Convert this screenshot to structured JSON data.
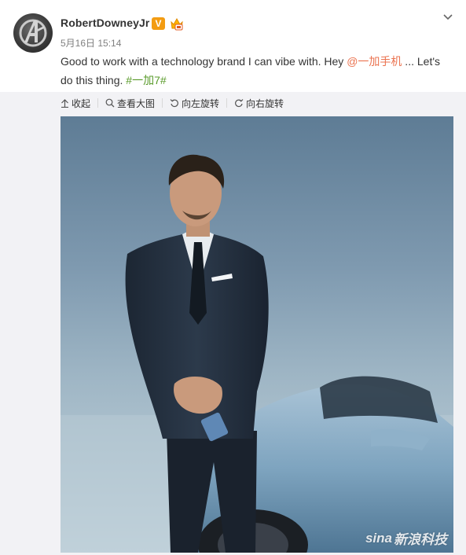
{
  "post": {
    "username": "RobertDowneyJr",
    "verified_badge": "V",
    "timestamp": "5月16日 15:14",
    "text_part1": "Good to work with a technology brand I can vibe with. Hey ",
    "mention": "@一加手机",
    "text_part2": " ... Let's do this thing. ",
    "hashtag": "#一加7#"
  },
  "toolbar": {
    "collapse": "收起",
    "view_large": "查看大图",
    "rotate_left": "向左旋转",
    "rotate_right": "向右旋转"
  },
  "image": {
    "watermark_logo": "sina",
    "watermark_text": "新浪科技"
  },
  "colors": {
    "mention": "#eb7350",
    "hashtag": "#5a9b2b",
    "verified": "#f39c12",
    "panel_bg": "#f2f2f5"
  }
}
